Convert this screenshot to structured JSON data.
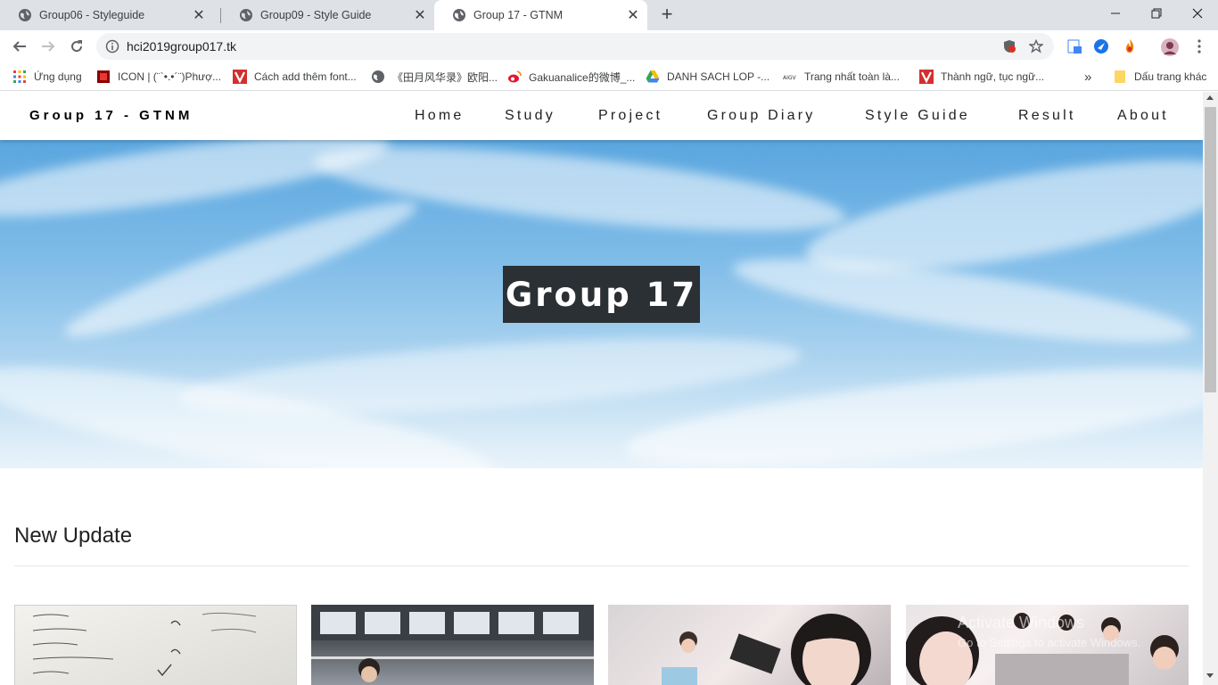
{
  "browser": {
    "tabs": [
      {
        "title": "Group06 - Styleguide",
        "active": false
      },
      {
        "title": "Group09 - Style Guide",
        "active": false
      },
      {
        "title": "Group 17 - GTNM",
        "active": true
      }
    ],
    "url": "hci2019group017.tk",
    "bookmarks": [
      {
        "label": "Ứng dụng",
        "icon": "apps-grid-icon"
      },
      {
        "label": "ICON | (¨`•.•´¨)Phượ...",
        "icon": "red-square-icon"
      },
      {
        "label": "Cách add thêm font...",
        "icon": "v-logo-icon"
      },
      {
        "label": "《田月风华录》欧阳...",
        "icon": "globe-icon"
      },
      {
        "label": "Gakuanalice的微博_...",
        "icon": "weibo-icon"
      },
      {
        "label": "DANH SACH LOP -...",
        "icon": "drive-icon"
      },
      {
        "label": "Trang nhất toàn là...",
        "icon": "aigv-icon"
      },
      {
        "label": "Thành ngữ, tục ngữ...",
        "icon": "v-logo-icon"
      }
    ],
    "overflow_label": "»",
    "other_bookmarks": "Dấu trang khác"
  },
  "site": {
    "brand": "Group 17 - GTNM",
    "nav": [
      "Home",
      "Study",
      "Project",
      "Group Diary",
      "Style Guide",
      "Result",
      "About"
    ],
    "hero_title": "Group 17",
    "section_title": "New Update",
    "watermark": "Activate Windows",
    "watermark_sub": "Go to Settings to activate Windows."
  },
  "colors": {
    "hero_title_bg": "#2b3035",
    "tab_strip": "#dee1e6"
  }
}
